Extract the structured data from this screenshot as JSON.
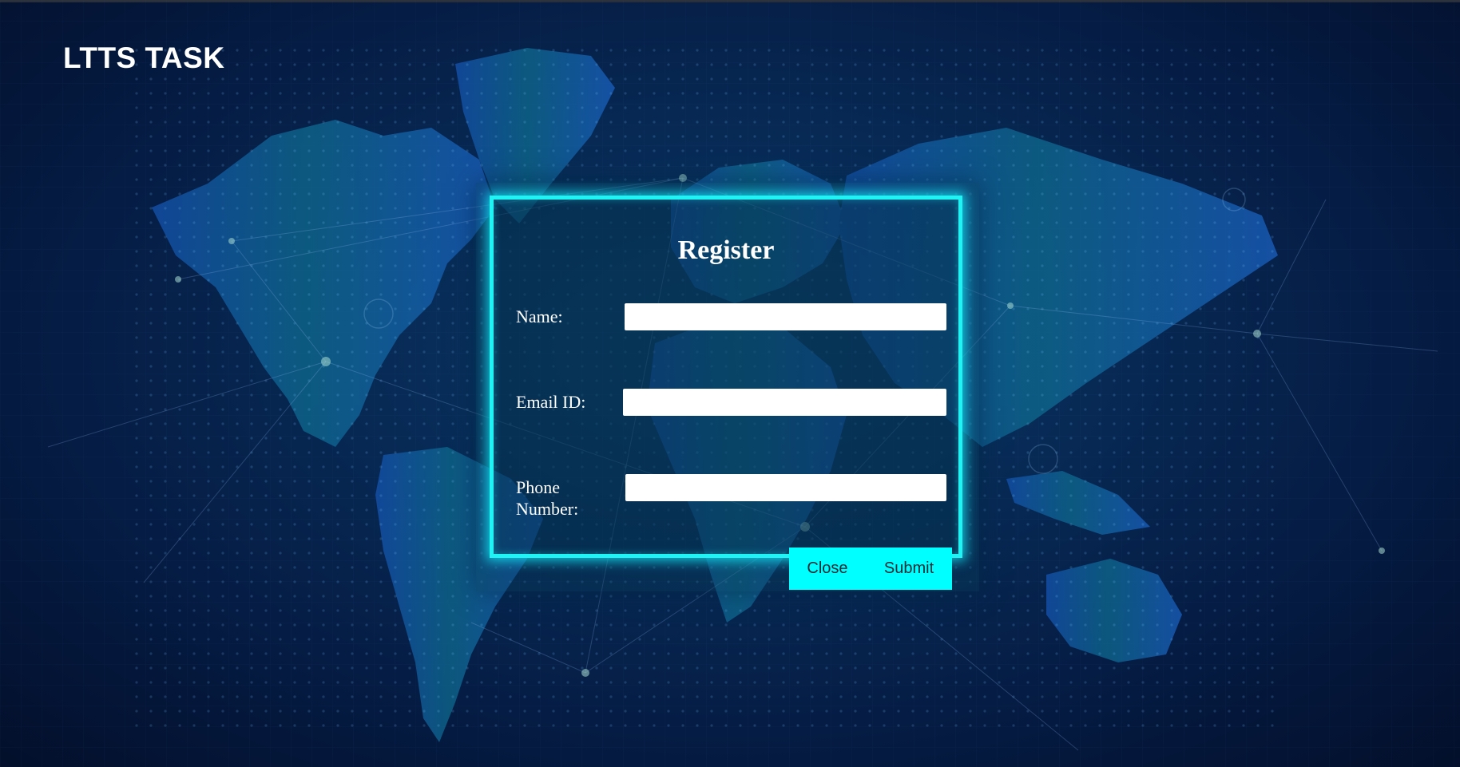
{
  "app": {
    "title": "LTTS TASK"
  },
  "form": {
    "title": "Register",
    "fields": [
      {
        "label": "Name:",
        "value": "",
        "placeholder": ""
      },
      {
        "label": "Email ID:",
        "value": "",
        "placeholder": ""
      },
      {
        "label": "Phone Number:",
        "value": "",
        "placeholder": ""
      }
    ],
    "buttons": {
      "close_label": "Close",
      "submit_label": "Submit"
    }
  },
  "colors": {
    "accent": "#00ffff",
    "background": "#072a55",
    "text": "#ffffff"
  },
  "icons": {
    "background": "world-map-network-graphic"
  }
}
